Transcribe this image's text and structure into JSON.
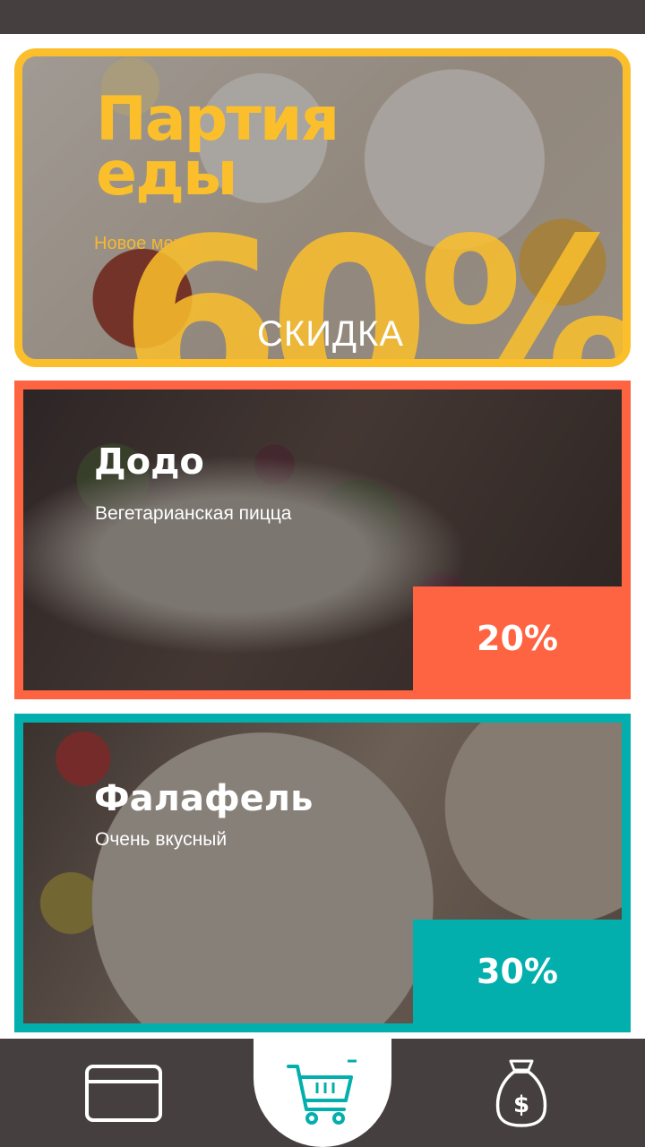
{
  "promo": {
    "title_line1": "Партия",
    "title_line2": "еды",
    "subtitle": "Новое меню",
    "big_value": "60%",
    "discount_label": "СКИДКА",
    "accent_color": "#fbbf2c"
  },
  "offers": [
    {
      "name": "Додо",
      "description": "Вегетарианская пицца",
      "discount": "20%",
      "color": "#fe6441"
    },
    {
      "name": "Фалафель",
      "description": "Очень вкусный",
      "discount": "30%",
      "color": "#03afac"
    }
  ],
  "nav": {
    "items": [
      {
        "icon": "credit-card-icon",
        "active": false
      },
      {
        "icon": "shopping-cart-icon",
        "active": true
      },
      {
        "icon": "money-bag-icon",
        "active": false
      }
    ],
    "money_symbol": "$"
  },
  "colors": {
    "bar": "#463f40"
  }
}
